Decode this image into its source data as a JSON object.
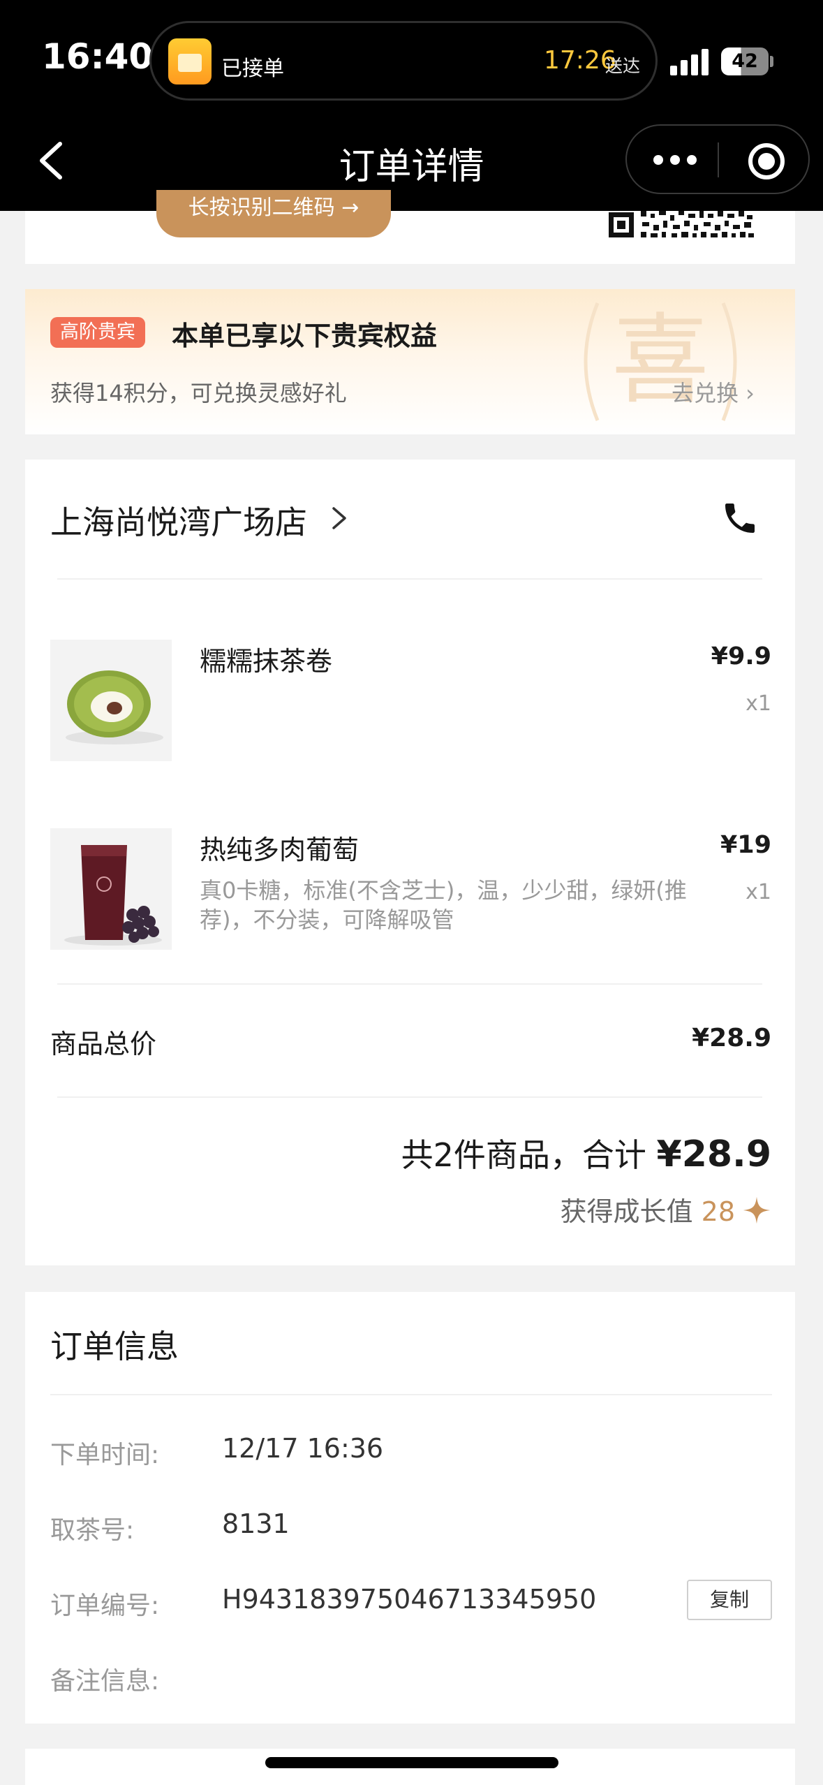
{
  "status_bar": {
    "time": "16:40",
    "order_status": "已接单",
    "eta_time": "17:26",
    "eta_suffix": "送达",
    "battery": "42"
  },
  "nav": {
    "title": "订单详情"
  },
  "qr_section": {
    "button_label": "长按识别二维码 →"
  },
  "vip": {
    "badge": "高阶贵宾",
    "title": "本单已享以下贵宾权益",
    "points_text": "获得14积分，可兑换灵感好礼",
    "redeem_label": "去兑换 ›",
    "watermark": "喜"
  },
  "store": {
    "name": "上海尚悦湾广场店"
  },
  "items": [
    {
      "name": "糯糯抹茶卷",
      "spec": "",
      "price": "¥9.9",
      "qty": "x1"
    },
    {
      "name": "热纯多肉葡萄",
      "spec": "真0卡糖，标准(不含芝士)，温，少少甜，绿妍(推荐)，不分装，可降解吸管",
      "price": "¥19",
      "qty": "x1"
    }
  ],
  "summary": {
    "subtotal_label": "商品总价",
    "subtotal_value": "¥28.9",
    "total_prefix": "共2件商品，合计 ",
    "total_value": "¥28.9",
    "growth_label": "获得成长值 ",
    "growth_value": "28"
  },
  "order_info": {
    "title": "订单信息",
    "rows": [
      {
        "label": "下单时间:",
        "value": "12/17 16:36"
      },
      {
        "label": "取茶号:",
        "value": "8131"
      },
      {
        "label": "订单编号:",
        "value": "H943183975046713345950"
      },
      {
        "label": "备注信息:",
        "value": ""
      }
    ],
    "copy_label": "复制"
  },
  "colors": {
    "accent_gold": "#c9935b",
    "badge_red": "#f26f55",
    "eta_yellow": "#ffc83d"
  }
}
